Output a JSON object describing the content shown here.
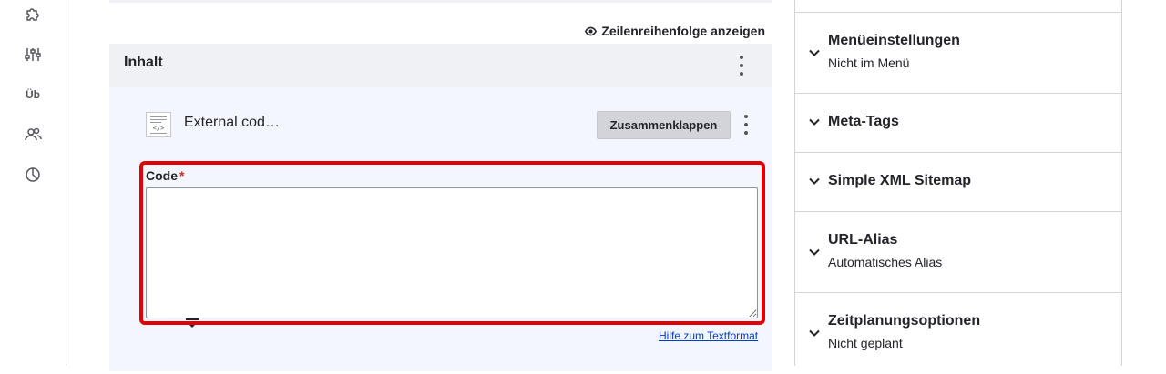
{
  "sidebar": {
    "items": [
      {
        "icon": "puzzle-icon"
      },
      {
        "icon": "sliders-icon"
      },
      {
        "label": "Üb"
      },
      {
        "icon": "users-icon"
      },
      {
        "icon": "pie-chart-icon"
      }
    ]
  },
  "main": {
    "row_order_label": "Zeilenreihenfolge anzeigen",
    "panel": {
      "title": "Inhalt",
      "paragraph": {
        "icon_tag": "</>",
        "title": "External cod…",
        "collapse_label": "Zusammenklappen"
      },
      "code_field": {
        "label": "Code",
        "required_mark": "*",
        "value": ""
      },
      "help_link": "Hilfe zum Textformat"
    }
  },
  "right_column": {
    "sections": [
      {
        "title": "Menüeinstellungen",
        "summary": "Nicht im Menü"
      },
      {
        "title": "Meta-Tags",
        "summary": ""
      },
      {
        "title": "Simple XML Sitemap",
        "summary": ""
      },
      {
        "title": "URL-Alias",
        "summary": "Automatisches Alias"
      },
      {
        "title": "Zeitplanungsoptionen",
        "summary": "Nicht geplant"
      }
    ]
  },
  "colors": {
    "highlight": "#e00000",
    "panel_bg": "#f3f6fd",
    "link": "#003cc5",
    "required": "#dc2323"
  }
}
